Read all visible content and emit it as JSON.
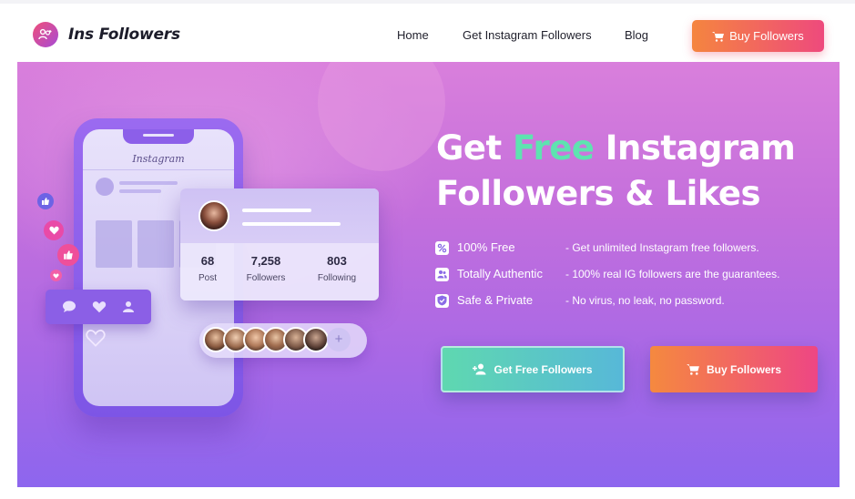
{
  "nav": {
    "logo_text": "Ins Followers",
    "links": [
      "Home",
      "Get Instagram Followers",
      "Blog"
    ],
    "buy_label": "Buy Followers"
  },
  "hero": {
    "title_part1": "Get ",
    "title_free": "Free",
    "title_part2": " Instagram",
    "title_line2": "Followers & Likes",
    "features": [
      {
        "name": "100% Free",
        "desc": "- Get unlimited Instagram free followers.",
        "icon": "percent-icon"
      },
      {
        "name": "Totally Authentic",
        "desc": "- 100% real IG followers are the guarantees.",
        "icon": "users-icon"
      },
      {
        "name": "Safe & Private",
        "desc": "- No virus, no leak, no password.",
        "icon": "shield-check-icon"
      }
    ],
    "btn_free_label": "Get Free Followers",
    "btn_buy_label": "Buy Followers"
  },
  "illustration": {
    "app_name": "Instagram",
    "stats": [
      {
        "value": "68",
        "label": "Post"
      },
      {
        "value": "7,258",
        "label": "Followers"
      },
      {
        "value": "803",
        "label": "Following"
      }
    ],
    "plus_symbol": "+"
  },
  "colors": {
    "accent_free": "#5ee3b0",
    "buy_gradient_start": "#f5853f",
    "buy_gradient_end": "#ee4a7d",
    "hero_top": "#d97fdc",
    "hero_bottom": "#8d66ee"
  }
}
